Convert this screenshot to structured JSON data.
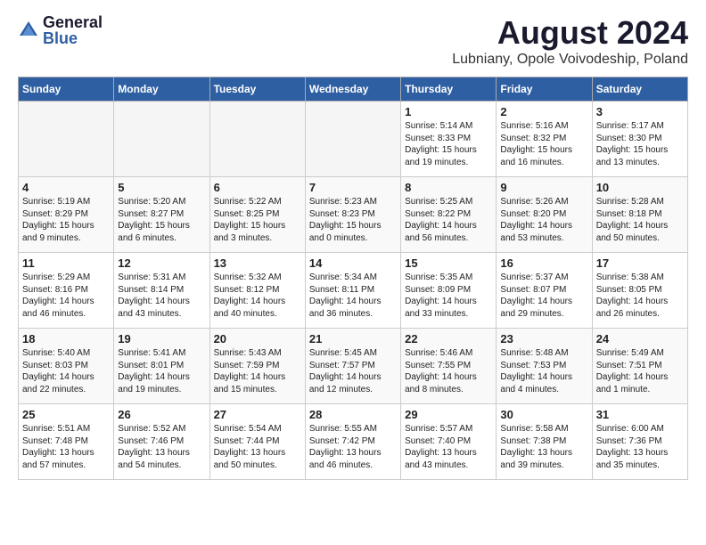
{
  "header": {
    "logo_general": "General",
    "logo_blue": "Blue",
    "main_title": "August 2024",
    "subtitle": "Lubniany, Opole Voivodeship, Poland"
  },
  "columns": [
    "Sunday",
    "Monday",
    "Tuesday",
    "Wednesday",
    "Thursday",
    "Friday",
    "Saturday"
  ],
  "weeks": [
    [
      {
        "day": "",
        "info": ""
      },
      {
        "day": "",
        "info": ""
      },
      {
        "day": "",
        "info": ""
      },
      {
        "day": "",
        "info": ""
      },
      {
        "day": "1",
        "info": "Sunrise: 5:14 AM\nSunset: 8:33 PM\nDaylight: 15 hours\nand 19 minutes."
      },
      {
        "day": "2",
        "info": "Sunrise: 5:16 AM\nSunset: 8:32 PM\nDaylight: 15 hours\nand 16 minutes."
      },
      {
        "day": "3",
        "info": "Sunrise: 5:17 AM\nSunset: 8:30 PM\nDaylight: 15 hours\nand 13 minutes."
      }
    ],
    [
      {
        "day": "4",
        "info": "Sunrise: 5:19 AM\nSunset: 8:29 PM\nDaylight: 15 hours\nand 9 minutes."
      },
      {
        "day": "5",
        "info": "Sunrise: 5:20 AM\nSunset: 8:27 PM\nDaylight: 15 hours\nand 6 minutes."
      },
      {
        "day": "6",
        "info": "Sunrise: 5:22 AM\nSunset: 8:25 PM\nDaylight: 15 hours\nand 3 minutes."
      },
      {
        "day": "7",
        "info": "Sunrise: 5:23 AM\nSunset: 8:23 PM\nDaylight: 15 hours\nand 0 minutes."
      },
      {
        "day": "8",
        "info": "Sunrise: 5:25 AM\nSunset: 8:22 PM\nDaylight: 14 hours\nand 56 minutes."
      },
      {
        "day": "9",
        "info": "Sunrise: 5:26 AM\nSunset: 8:20 PM\nDaylight: 14 hours\nand 53 minutes."
      },
      {
        "day": "10",
        "info": "Sunrise: 5:28 AM\nSunset: 8:18 PM\nDaylight: 14 hours\nand 50 minutes."
      }
    ],
    [
      {
        "day": "11",
        "info": "Sunrise: 5:29 AM\nSunset: 8:16 PM\nDaylight: 14 hours\nand 46 minutes."
      },
      {
        "day": "12",
        "info": "Sunrise: 5:31 AM\nSunset: 8:14 PM\nDaylight: 14 hours\nand 43 minutes."
      },
      {
        "day": "13",
        "info": "Sunrise: 5:32 AM\nSunset: 8:12 PM\nDaylight: 14 hours\nand 40 minutes."
      },
      {
        "day": "14",
        "info": "Sunrise: 5:34 AM\nSunset: 8:11 PM\nDaylight: 14 hours\nand 36 minutes."
      },
      {
        "day": "15",
        "info": "Sunrise: 5:35 AM\nSunset: 8:09 PM\nDaylight: 14 hours\nand 33 minutes."
      },
      {
        "day": "16",
        "info": "Sunrise: 5:37 AM\nSunset: 8:07 PM\nDaylight: 14 hours\nand 29 minutes."
      },
      {
        "day": "17",
        "info": "Sunrise: 5:38 AM\nSunset: 8:05 PM\nDaylight: 14 hours\nand 26 minutes."
      }
    ],
    [
      {
        "day": "18",
        "info": "Sunrise: 5:40 AM\nSunset: 8:03 PM\nDaylight: 14 hours\nand 22 minutes."
      },
      {
        "day": "19",
        "info": "Sunrise: 5:41 AM\nSunset: 8:01 PM\nDaylight: 14 hours\nand 19 minutes."
      },
      {
        "day": "20",
        "info": "Sunrise: 5:43 AM\nSunset: 7:59 PM\nDaylight: 14 hours\nand 15 minutes."
      },
      {
        "day": "21",
        "info": "Sunrise: 5:45 AM\nSunset: 7:57 PM\nDaylight: 14 hours\nand 12 minutes."
      },
      {
        "day": "22",
        "info": "Sunrise: 5:46 AM\nSunset: 7:55 PM\nDaylight: 14 hours\nand 8 minutes."
      },
      {
        "day": "23",
        "info": "Sunrise: 5:48 AM\nSunset: 7:53 PM\nDaylight: 14 hours\nand 4 minutes."
      },
      {
        "day": "24",
        "info": "Sunrise: 5:49 AM\nSunset: 7:51 PM\nDaylight: 14 hours\nand 1 minute."
      }
    ],
    [
      {
        "day": "25",
        "info": "Sunrise: 5:51 AM\nSunset: 7:48 PM\nDaylight: 13 hours\nand 57 minutes."
      },
      {
        "day": "26",
        "info": "Sunrise: 5:52 AM\nSunset: 7:46 PM\nDaylight: 13 hours\nand 54 minutes."
      },
      {
        "day": "27",
        "info": "Sunrise: 5:54 AM\nSunset: 7:44 PM\nDaylight: 13 hours\nand 50 minutes."
      },
      {
        "day": "28",
        "info": "Sunrise: 5:55 AM\nSunset: 7:42 PM\nDaylight: 13 hours\nand 46 minutes."
      },
      {
        "day": "29",
        "info": "Sunrise: 5:57 AM\nSunset: 7:40 PM\nDaylight: 13 hours\nand 43 minutes."
      },
      {
        "day": "30",
        "info": "Sunrise: 5:58 AM\nSunset: 7:38 PM\nDaylight: 13 hours\nand 39 minutes."
      },
      {
        "day": "31",
        "info": "Sunrise: 6:00 AM\nSunset: 7:36 PM\nDaylight: 13 hours\nand 35 minutes."
      }
    ]
  ]
}
